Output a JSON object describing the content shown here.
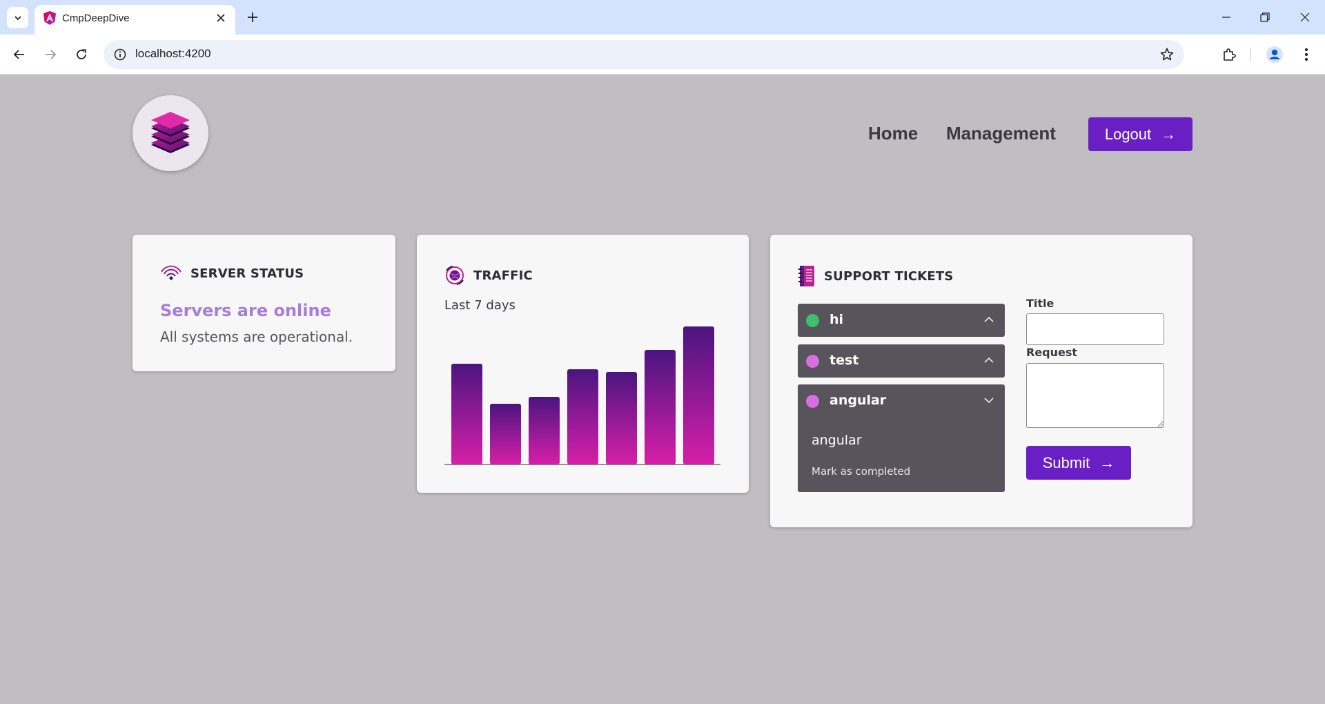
{
  "browser": {
    "tab_title": "CmpDeepDive",
    "url": "localhost:4200",
    "icons": [
      "tab-search-icon",
      "angular-favicon-icon",
      "close-icon",
      "plus-icon",
      "back-icon",
      "forward-icon",
      "reload-icon",
      "info-icon",
      "star-icon",
      "extensions-icon",
      "profile-icon",
      "kebab-menu-icon",
      "minimize-icon",
      "restore-icon",
      "close-window-icon"
    ]
  },
  "header": {
    "logo_icon": "stacked-layers-logo",
    "nav": {
      "home": "Home",
      "management": "Management"
    },
    "logout_label": "Logout",
    "logout_arrow": "→",
    "accent_color": "#6a1fc4"
  },
  "server_status": {
    "title": "SERVER STATUS",
    "icon": "signal-waves-icon",
    "heading": "Servers are online",
    "text": "All systems are operational."
  },
  "traffic": {
    "title": "TRAFFIC",
    "icon": "globe-icon",
    "subtitle": "Last 7 days"
  },
  "chart_data": {
    "type": "bar",
    "categories": [
      "",
      "",
      "",
      "",
      "",
      "",
      ""
    ],
    "values": [
      73,
      44,
      49,
      69,
      67,
      83,
      100
    ],
    "ylim": [
      0,
      100
    ],
    "gradient": [
      "#4a1580",
      "#d61fa8"
    ]
  },
  "support_tickets": {
    "title": "SUPPORT TICKETS",
    "icon": "notebook-icon",
    "tickets": [
      {
        "title": "hi",
        "status_color": "#3dbf6b",
        "expanded": false
      },
      {
        "title": "test",
        "status_color": "#d86ee0",
        "expanded": false
      },
      {
        "title": "angular",
        "status_color": "#d86ee0",
        "expanded": true,
        "request": "angular",
        "action": "Mark as completed"
      }
    ],
    "form": {
      "title_label": "Title",
      "title_value": "",
      "request_label": "Request",
      "request_value": "",
      "submit_label": "Submit",
      "submit_arrow": "→"
    }
  }
}
